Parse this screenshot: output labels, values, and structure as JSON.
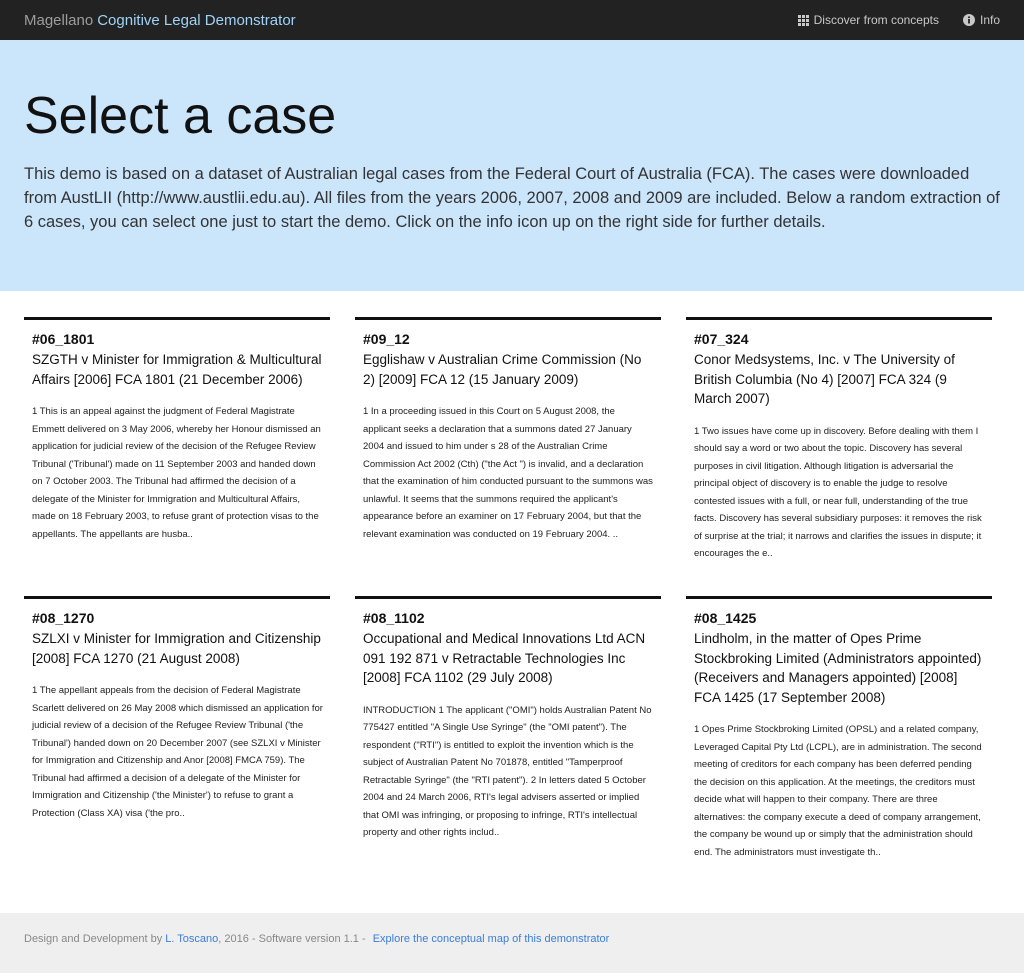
{
  "navbar": {
    "brand": "Magellano",
    "brand_accent": "Cognitive Legal Demonstrator",
    "discover_label": "Discover from concepts",
    "info_label": "Info"
  },
  "hero": {
    "title": "Select a case",
    "description": "This demo is based on a dataset of Australian legal cases from the Federal Court of Australia (FCA). The cases were downloaded from AustLII (http://www.austlii.edu.au). All files from the years 2006, 2007, 2008 and 2009 are included. Below a random extraction of 6 cases, you can select one just to start the demo. Click on the info icon up on the right side for further details."
  },
  "cases": [
    {
      "id": "#06_1801",
      "title": "SZGTH v Minister for Immigration & Multicultural Affairs [2006] FCA 1801 (21 December 2006)",
      "excerpt": "1 This is an appeal against the judgment of Federal Magistrate Emmett delivered on 3 May 2006, whereby her Honour dismissed an application for judicial review of the decision of the Refugee Review Tribunal ('Tribunal') made on 11 September 2003 and handed down on 7 October 2003. The Tribunal had affirmed the decision of a delegate of the Minister for Immigration and Multicultural Affairs, made on 18 February 2003, to refuse grant of protection visas to the appellants. The appellants are husba.."
    },
    {
      "id": "#09_12",
      "title": "Egglishaw v Australian Crime Commission (No 2) [2009] FCA 12 (15 January 2009)",
      "excerpt": "1 In a proceeding issued in this Court on 5 August 2008, the applicant seeks a declaration that a summons dated 27 January 2004 and issued to him under s 28 of the Australian Crime Commission Act 2002 (Cth) (\"the Act \") is invalid, and a declaration that the examination of him conducted pursuant to the summons was unlawful. It seems that the summons required the applicant's appearance before an examiner on 17 February 2004, but that the relevant examination was conducted on 19 February 2004. .."
    },
    {
      "id": "#07_324",
      "title": "Conor Medsystems, Inc. v The University of British Columbia (No 4) [2007] FCA 324 (9 March 2007)",
      "excerpt": "1 Two issues have come up in discovery. Before dealing with them I should say a word or two about the topic. Discovery has several purposes in civil litigation. Although litigation is adversarial the principal object of discovery is to enable the judge to resolve contested issues with a full, or near full, understanding of the true facts. Discovery has several subsidiary purposes: it removes the risk of surprise at the trial; it narrows and clarifies the issues in dispute; it encourages the e.."
    },
    {
      "id": "#08_1270",
      "title": "SZLXI v Minister for Immigration and Citizenship [2008] FCA 1270 (21 August 2008)",
      "excerpt": "1 The appellant appeals from the decision of Federal Magistrate Scarlett delivered on 26 May 2008 which dismissed an application for judicial review of a decision of the Refugee Review Tribunal ('the Tribunal') handed down on 20 December 2007 (see SZLXI v Minister for Immigration and Citizenship and Anor [2008] FMCA 759). The Tribunal had affirmed a decision of a delegate of the Minister for Immigration and Citizenship ('the Minister') to refuse to grant a Protection (Class XA) visa ('the pro.."
    },
    {
      "id": "#08_1102",
      "title": "Occupational and Medical Innovations Ltd ACN 091 192 871 v Retractable Technologies Inc [2008] FCA 1102 (29 July 2008)",
      "excerpt": "INTRODUCTION 1 The applicant (\"OMI\") holds Australian Patent No 775427 entitled \"A Single Use Syringe\" (the \"OMI patent\"). The respondent (\"RTI\") is entitled to exploit the invention which is the subject of Australian Patent No 701878, entitled \"Tamperproof Retractable Syringe\" (the \"RTI patent\"). 2 In letters dated 5 October 2004 and 24 March 2006, RTI's legal advisers asserted or implied that OMI was infringing, or proposing to infringe, RTI's intellectual property and other rights includ.."
    },
    {
      "id": "#08_1425",
      "title": "Lindholm, in the matter of Opes Prime Stockbroking Limited (Administrators appointed) (Receivers and Managers appointed) [2008] FCA 1425 (17 September 2008)",
      "excerpt": "1 Opes Prime Stockbroking Limited (OPSL) and a related company, Leveraged Capital Pty Ltd (LCPL), are in administration. The second meeting of creditors for each company has been deferred pending the decision on this application. At the meetings, the creditors must decide what will happen to their company. There are three alternatives: the company execute a deed of company arrangement, the company be wound up or simply that the administration should end. The administrators must investigate th.."
    }
  ],
  "footer": {
    "prefix": "Design and Development by",
    "author": "L. Toscano",
    "suffix": ", 2016 - Software version 1.1 -",
    "map_link": "Explore the conceptual map of this demonstrator"
  }
}
